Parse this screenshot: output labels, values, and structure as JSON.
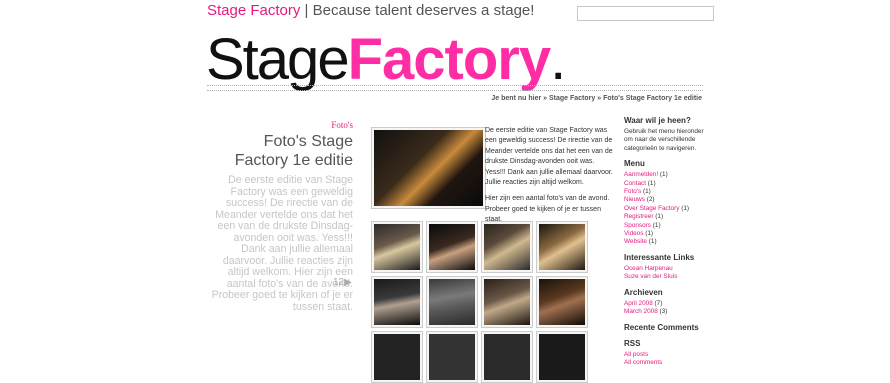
{
  "header": {
    "brand": "Stage Factory",
    "tagline": " | Because talent deserves a stage!",
    "search_placeholder": ""
  },
  "logo": {
    "stage": "Stage",
    "factory": "Factory",
    "dot": "."
  },
  "breadcrumb": {
    "prefix": "Je bent nu hier »",
    "item1": "Stage Factory",
    "sep": " » ",
    "item2": "Foto's Stage Factory 1e editie"
  },
  "post": {
    "category": "Foto's",
    "title": "Foto's Stage Factory 1e editie",
    "excerpt": "De eerste editie van Stage Factory was een geweldig success! De rirectie van de Meander vertelde ons dat het een van de drukste Dinsdag-avonden ooit was. Yess!!! Dank aan jullie allemaal daarvoor. Jullie reacties zijn altijd welkom. Hier zijn een aantal foto's van de avond. Probeer goed te kijken of je er tussen staat.",
    "page_label": "12",
    "page_arrow": "▶",
    "intro_p1": "De eerste editie van Stage Factory was een geweldig success! De rirectie van de Meander vertelde ons dat het een van de drukste Dinsdag-avonden ooit was. Yess!!! Dank aan jullie allemaal daarvoor. Jullie reacties zijn altijd welkom.",
    "intro_p2": "Hier zijn een aantal foto's van de avond. Probeer goed te kijken of je er tussen staat."
  },
  "sidebar": {
    "where_title": "Waar wil je heen?",
    "where_desc": "Gebruik het menu hieronder om naar de verschillende categorieën te navigeren.",
    "menu_title": "Menu",
    "menu": [
      {
        "label": "Aanmelden!",
        "count": " (1)"
      },
      {
        "label": "Contact",
        "count": " (1)"
      },
      {
        "label": "Foto's",
        "count": " (1)"
      },
      {
        "label": "Nieuws",
        "count": " (2)"
      },
      {
        "label": "Over Stage Factory",
        "count": " (1)"
      },
      {
        "label": "Registreer",
        "count": " (1)"
      },
      {
        "label": "Sponsors",
        "count": " (1)"
      },
      {
        "label": "Videos",
        "count": " (1)"
      },
      {
        "label": "Website",
        "count": " (1)"
      }
    ],
    "links_title": "Interessante Links",
    "links": [
      {
        "label": "Ocean Harpenau"
      },
      {
        "label": "Suze van der Sluis"
      }
    ],
    "archive_title": "Archieven",
    "archive": [
      {
        "label": "April 2008",
        "count": " (7)"
      },
      {
        "label": "March 2008",
        "count": " (3)"
      }
    ],
    "recent_title": "Recente Comments",
    "rss_title": "RSS",
    "rss": [
      {
        "label": "All posts"
      },
      {
        "label": "All comments"
      }
    ]
  },
  "colors": {
    "accent": "#e6197f",
    "logo_pink": "#ff2da5"
  }
}
